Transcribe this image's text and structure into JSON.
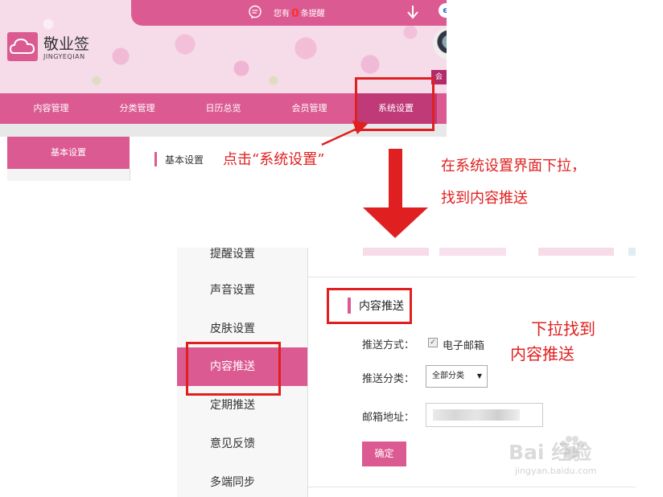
{
  "top": {
    "notice": {
      "prefix": "您有",
      "count": "0",
      "suffix": "条提醒"
    },
    "logo": {
      "title": "敬业签",
      "subtitle": "JINGYEQIAN"
    },
    "member_tag": "会",
    "nav": [
      "内容管理",
      "分类管理",
      "日历总览",
      "会员管理",
      "系统设置"
    ],
    "sidebar_active": "基本设置",
    "section_title": "基本设置"
  },
  "annotations": {
    "click_hint": "点击“系统设置”",
    "scroll_hint_line1": "在系统设置界面下拉，",
    "scroll_hint_line2": "找到内容推送",
    "found_hint_line1": "下拉找到",
    "found_hint_line2": "内容推送"
  },
  "bottom": {
    "sidebar": [
      "提醒设置",
      "声音设置",
      "皮肤设置",
      "内容推送",
      "定期推送",
      "意见反馈",
      "多端同步"
    ],
    "section_title": "内容推送",
    "push_method_label": "推送方式：",
    "push_method_option": "电子邮箱",
    "push_category_label": "推送分类：",
    "push_category_value": "全部分类",
    "email_label": "邮箱地址：",
    "confirm_label": "确定"
  },
  "watermark": {
    "text": "Bai  经验",
    "url": "jingyan.baidu.com"
  },
  "colors": {
    "brand_pink": "#dc5a92",
    "annotation_red": "#e02020"
  }
}
